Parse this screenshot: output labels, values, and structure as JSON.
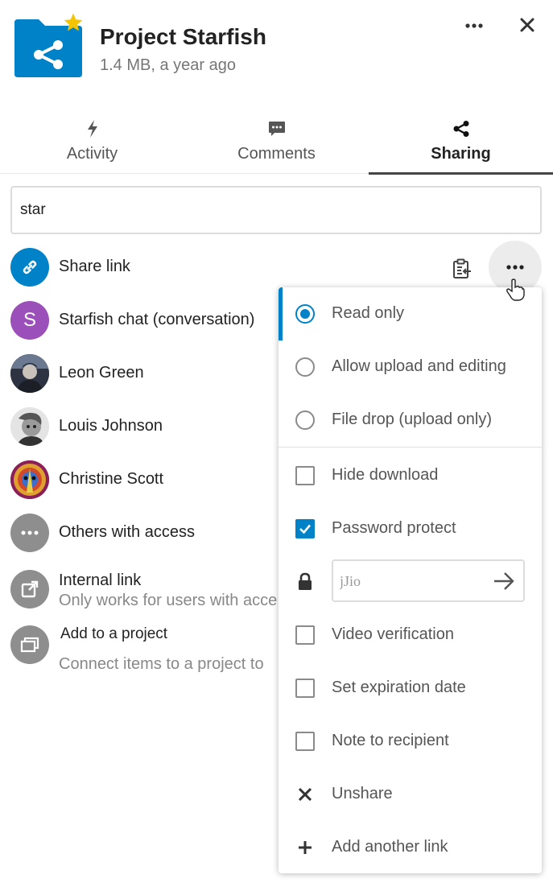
{
  "header": {
    "title": "Project Starfish",
    "subtitle": "1.4 MB, a year ago",
    "folder_icon": "shared-folder-icon",
    "favorite_icon": "star-icon",
    "colors": {
      "brand": "#0082c9",
      "star": "#f4c400"
    }
  },
  "tabs": [
    {
      "label": "Activity",
      "icon": "lightning-icon",
      "active": false
    },
    {
      "label": "Comments",
      "icon": "comment-icon",
      "active": false
    },
    {
      "label": "Sharing",
      "icon": "share-icon",
      "active": true
    }
  ],
  "search": {
    "value": "star",
    "placeholder": ""
  },
  "share_list": [
    {
      "label": "Share link",
      "icon": "link-icon"
    },
    {
      "label": "Starfish chat (conversation)",
      "avatar_letter": "S",
      "avatar_color": "#9b4fb8"
    },
    {
      "label": "Leon Green"
    },
    {
      "label": "Louis Johnson"
    },
    {
      "label": "Christine Scott"
    },
    {
      "label": "Others with access",
      "icon": "more-icon"
    },
    {
      "label": "Internal link",
      "sub": "Only works for users with acce",
      "icon": "external-link-icon"
    },
    {
      "label": "Add to a project",
      "sub": "Connect items to a project to",
      "icon": "project-icon"
    }
  ],
  "popover": {
    "permissions": [
      {
        "label": "Read only",
        "checked": true
      },
      {
        "label": "Allow upload and editing",
        "checked": false
      },
      {
        "label": "File drop (upload only)",
        "checked": false
      }
    ],
    "options": [
      {
        "label": "Hide download",
        "checked": false
      },
      {
        "label": "Password protect",
        "checked": true
      }
    ],
    "password": {
      "value": "jJio",
      "placeholder": ""
    },
    "options2": [
      {
        "label": "Video verification",
        "checked": false
      },
      {
        "label": "Set expiration date",
        "checked": false
      },
      {
        "label": "Note to recipient",
        "checked": false
      }
    ],
    "actions": [
      {
        "label": "Unshare",
        "icon": "close-icon"
      },
      {
        "label": "Add another link",
        "icon": "plus-icon"
      }
    ]
  }
}
